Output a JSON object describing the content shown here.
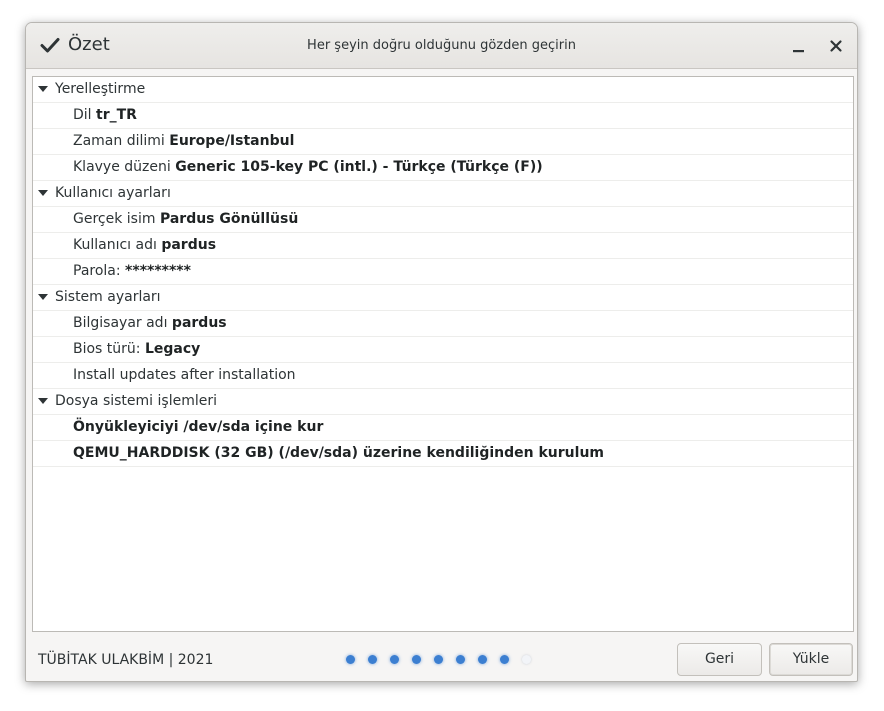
{
  "window": {
    "title": "Özet",
    "subtitle": "Her şeyin doğru olduğunu gözden geçirin",
    "minimize_icon": "minimize-icon",
    "close_icon": "close-icon"
  },
  "summary": {
    "groups": [
      {
        "label": "Yerelleştirme",
        "items": [
          {
            "prefix": "Dil ",
            "value": "tr_TR"
          },
          {
            "prefix": "Zaman dilimi ",
            "value": "Europe/Istanbul"
          },
          {
            "prefix": "Klavye düzeni ",
            "value": "Generic 105-key PC (intl.) - Türkçe (Türkçe (F))"
          }
        ]
      },
      {
        "label": "Kullanıcı ayarları",
        "items": [
          {
            "prefix": "Gerçek isim ",
            "value": "Pardus Gönüllüsü"
          },
          {
            "prefix": "Kullanıcı adı ",
            "value": "pardus"
          },
          {
            "prefix": "Parola: ",
            "value": "*********"
          }
        ]
      },
      {
        "label": "Sistem ayarları",
        "items": [
          {
            "prefix": "Bilgisayar adı ",
            "value": "pardus"
          },
          {
            "prefix": "Bios türü: ",
            "value": "Legacy"
          },
          {
            "prefix": "Install updates after installation",
            "value": ""
          }
        ]
      },
      {
        "label": "Dosya sistemi işlemleri",
        "items": [
          {
            "prefix": "",
            "value": "Önyükleyiciyi /dev/sda içine kur"
          },
          {
            "prefix": "",
            "value": "QEMU_HARDDISK (32 GB) (/dev/sda) üzerine kendiliğinden kurulum"
          }
        ]
      }
    ]
  },
  "footer": {
    "text": "TÜBİTAK ULAKBİM | 2021",
    "progress": {
      "total_steps": 9,
      "completed_steps": 8
    }
  },
  "buttons": {
    "back": "Geri",
    "install": "Yükle"
  },
  "colors": {
    "accent": "#3c7fd1"
  }
}
